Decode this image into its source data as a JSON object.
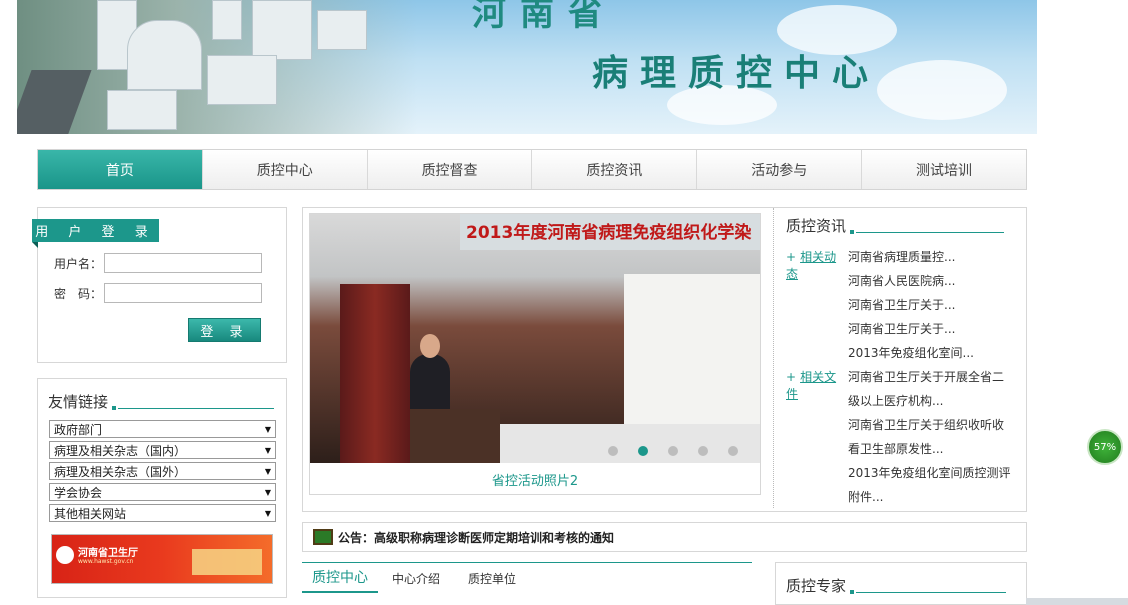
{
  "banner": {
    "title_line1": "河南省",
    "title_line2": "病理质控中心"
  },
  "nav": {
    "items": [
      {
        "label": "首页"
      },
      {
        "label": "质控中心"
      },
      {
        "label": "质控督查"
      },
      {
        "label": "质控资讯"
      },
      {
        "label": "活动参与"
      },
      {
        "label": "测试培训"
      }
    ]
  },
  "login": {
    "title": "用 户 登 录",
    "username_label": "用户名：",
    "password_label": "密　码：",
    "username_value": "",
    "password_value": "",
    "submit_label": "登 录"
  },
  "links": {
    "title": "友情链接",
    "selects": [
      {
        "label": "政府部门"
      },
      {
        "label": "病理及相关杂志（国内）"
      },
      {
        "label": "病理及相关杂志（国外）"
      },
      {
        "label": "学会协会"
      },
      {
        "label": "其他相关网站"
      }
    ],
    "promo": {
      "name": "河南省卫生厅",
      "url": "www.hawst.gov.cn"
    }
  },
  "slideshow": {
    "banner_text": "2013年度河南省病理免疫组织化学染",
    "caption": "省控活动照片2",
    "total_dots": 5,
    "active_dot": 2
  },
  "news": {
    "title": "质控资讯",
    "groups": [
      {
        "tag": "相关动态",
        "items": [
          "河南省病理质量控...",
          "河南省人民医院病...",
          "河南省卫生厅关于...",
          "河南省卫生厅关于...",
          "2013年免疫组化室间..."
        ]
      },
      {
        "tag": "相关文件",
        "items": [
          "河南省卫生厅关于开展全省二",
          "级以上医疗机构...",
          "河南省卫生厅关于组织收听收",
          "看卫生部原发性...",
          "2013年免疫组化室间质控测评",
          "附件..."
        ]
      }
    ]
  },
  "notice": {
    "text": "公告：高级职称病理诊断医师定期培训和考核的通知"
  },
  "bottom_tabs": {
    "items": [
      {
        "label": "质控中心"
      },
      {
        "label": "中心介绍"
      },
      {
        "label": "质控单位"
      }
    ]
  },
  "expert": {
    "title": "质控专家"
  },
  "badge": {
    "percent": "57%"
  }
}
